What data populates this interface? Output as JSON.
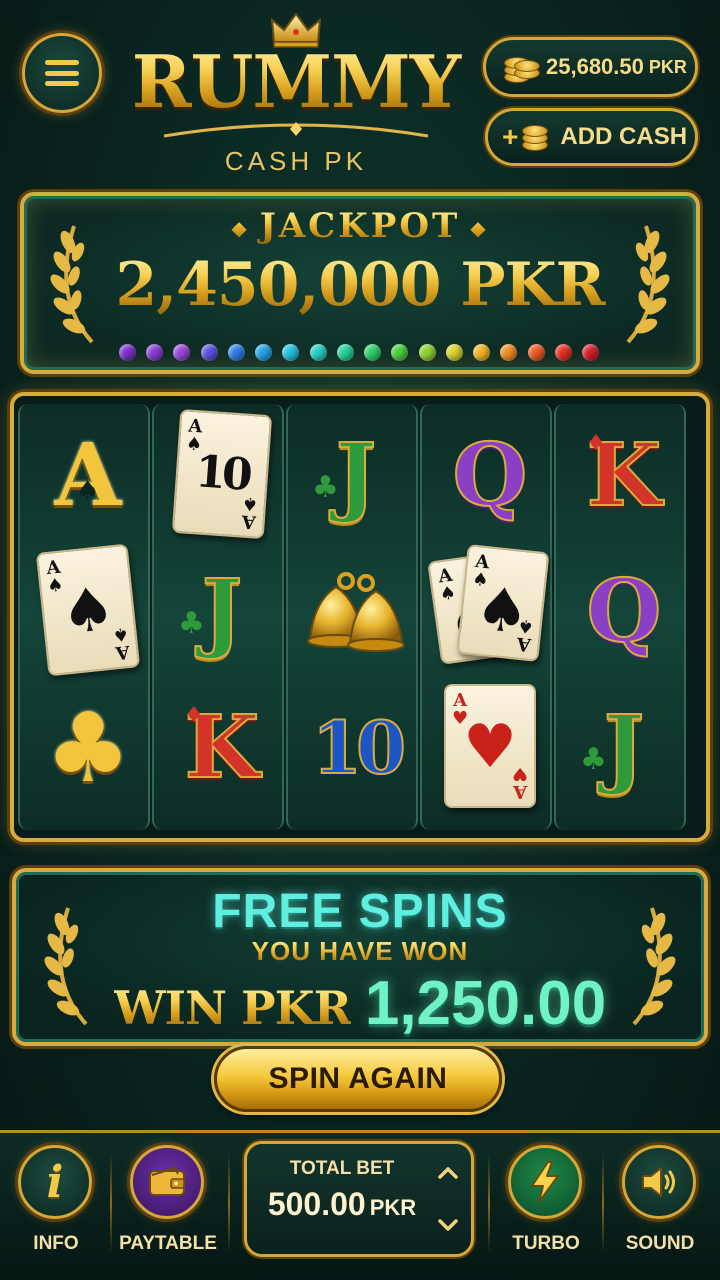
{
  "header": {
    "logo_title": "RUMMY",
    "logo_subtitle": "CASH PK",
    "balance": "25,680.50",
    "balance_currency": "PKR",
    "add_cash_label": "ADD CASH"
  },
  "jackpot": {
    "label": "JACKPOT",
    "amount": "2,450,000 PKR",
    "gem_colors": [
      "#7b2ecf",
      "#8b3ad6",
      "#9a44dc",
      "#5a52e0",
      "#2f7de6",
      "#22a3e8",
      "#1fc2e0",
      "#22d0c4",
      "#25d09a",
      "#2bcf6a",
      "#48cf3c",
      "#8ed12e",
      "#d9d12a",
      "#f0b624",
      "#f28c22",
      "#ec5a20",
      "#e3301f",
      "#d61d2c"
    ]
  },
  "reels": {
    "columns": [
      [
        {
          "type": "letter",
          "text": "A",
          "style": "gold",
          "suit": "♠"
        },
        {
          "type": "card",
          "rank": "A",
          "suit": "♠",
          "color": "black"
        },
        {
          "type": "club",
          "text": "♣"
        }
      ],
      [
        {
          "type": "card",
          "rank": "10",
          "suit": "♠",
          "color": "black",
          "corner_rank": "A"
        },
        {
          "type": "letter",
          "text": "J",
          "style": "green",
          "suit": "♣"
        },
        {
          "type": "letter",
          "text": "K",
          "style": "red",
          "suit": "♦"
        }
      ],
      [
        {
          "type": "letter",
          "text": "J",
          "style": "green",
          "suit": "♣"
        },
        {
          "type": "bells"
        },
        {
          "type": "letter",
          "text": "10",
          "style": "blue"
        }
      ],
      [
        {
          "type": "letter",
          "text": "Q",
          "style": "purple"
        },
        {
          "type": "cardpair",
          "rank": "A",
          "suit": "♠"
        },
        {
          "type": "card",
          "rank": "A",
          "suit": "♥",
          "color": "red"
        }
      ],
      [
        {
          "type": "letter",
          "text": "K",
          "style": "red",
          "suit": "♦"
        },
        {
          "type": "letter",
          "text": "Q",
          "style": "purple"
        },
        {
          "type": "letter",
          "text": "J",
          "style": "green",
          "suit": "♣"
        }
      ]
    ]
  },
  "free_spins": {
    "title": "FREE SPINS",
    "subtitle": "YOU HAVE WON",
    "win_label": "WIN PKR",
    "win_amount": "1,250.00"
  },
  "spin_button": {
    "label": "SPIN AGAIN"
  },
  "bottom_bar": {
    "info_label": "INFO",
    "paytable_label": "PAYTABLE",
    "total_bet_label": "TOTAL BET",
    "total_bet_value": "500.00",
    "total_bet_currency": "PKR",
    "turbo_label": "TURBO",
    "sound_label": "SOUND",
    "icons": [
      "info-icon",
      "wallet-icon",
      "chevron-up-icon",
      "chevron-down-icon",
      "lightning-icon",
      "speaker-icon"
    ]
  },
  "colors": {
    "gold": "#d9ab3d",
    "felt": "#0a2520",
    "cyan": "#5fefe0",
    "mint": "#6ff3c4"
  }
}
